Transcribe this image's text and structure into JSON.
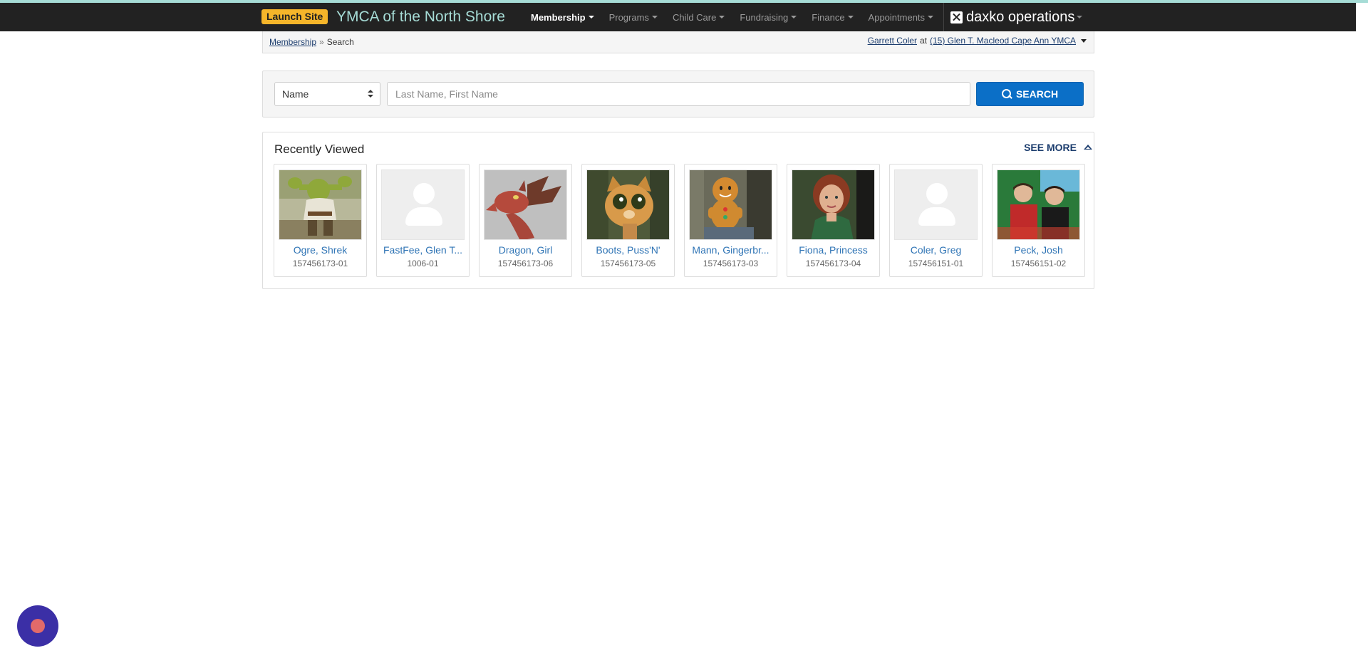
{
  "header": {
    "launch_label": "Launch Site",
    "site_title": "YMCA of the North Shore",
    "brand_label": "daxko operations",
    "colors": {
      "navbar": "#222222",
      "accent_stripe": "#a6dcd6",
      "launch": "#f5b52a"
    }
  },
  "nav": {
    "items": [
      {
        "label": "Membership",
        "active": true
      },
      {
        "label": "Programs"
      },
      {
        "label": "Child Care"
      },
      {
        "label": "Fundraising"
      },
      {
        "label": "Finance"
      },
      {
        "label": "Appointments"
      }
    ]
  },
  "breadcrumb": {
    "parent": "Membership",
    "separator": "»",
    "current": "Search"
  },
  "user": {
    "name": "Garrett Coler",
    "at": "at",
    "location": "(15) Glen T. Macleod Cape Ann YMCA"
  },
  "search": {
    "type_value": "Name",
    "placeholder": "Last Name, First Name",
    "button_label": "SEARCH",
    "button_color": "#0b6fc7"
  },
  "recent": {
    "title": "Recently Viewed",
    "see_more_label": "SEE MORE",
    "cards": [
      {
        "name": "Ogre, Shrek",
        "id": "157456173-01",
        "photo": "photo"
      },
      {
        "name": "FastFee, Glen T...",
        "id": "1006-01",
        "photo": "placeholder"
      },
      {
        "name": "Dragon, Girl",
        "id": "157456173-06",
        "photo": "photo"
      },
      {
        "name": "Boots, Puss'N'",
        "id": "157456173-05",
        "photo": "photo"
      },
      {
        "name": "Mann, Gingerbr...",
        "id": "157456173-03",
        "photo": "photo"
      },
      {
        "name": "Fiona, Princess",
        "id": "157456173-04",
        "photo": "photo"
      },
      {
        "name": "Coler, Greg",
        "id": "157456151-01",
        "photo": "placeholder"
      },
      {
        "name": "Peck, Josh",
        "id": "157456151-02",
        "photo": "photo"
      }
    ]
  }
}
